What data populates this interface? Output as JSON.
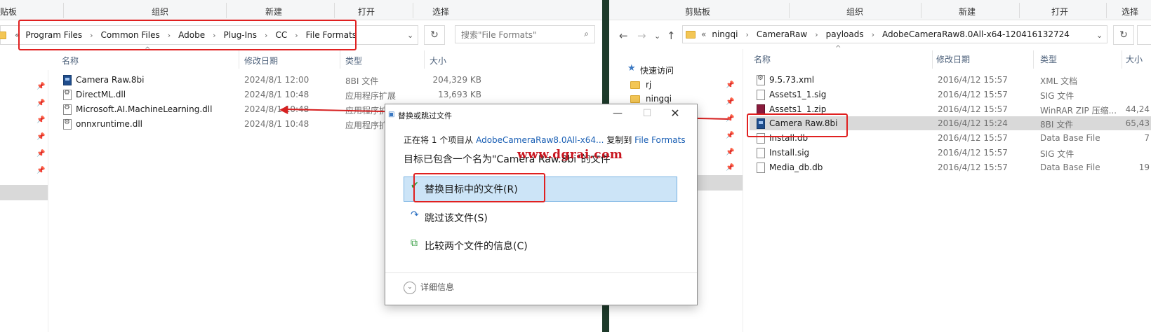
{
  "left": {
    "ribbon": [
      "贴板",
      "组织",
      "新建",
      "打开",
      "选择"
    ],
    "breadcrumb": [
      "Program Files",
      "Common Files",
      "Adobe",
      "Plug-Ins",
      "CC",
      "File Formats"
    ],
    "overflow": "«",
    "search_placeholder": "搜索\"File Formats\"",
    "columns": [
      "名称",
      "修改日期",
      "类型",
      "大小"
    ],
    "files": [
      {
        "name": "Camera Raw.8bi",
        "date": "2024/8/1 12:00",
        "type": "8BI 文件",
        "size": "204,329 KB",
        "icon": "camera-raw-icon"
      },
      {
        "name": "DirectML.dll",
        "date": "2024/8/1 10:48",
        "type": "应用程序扩展",
        "size": "13,693 KB",
        "icon": "dll-icon"
      },
      {
        "name": "Microsoft.AI.MachineLearning.dll",
        "date": "2024/8/1 10:48",
        "type": "应用程序扩",
        "size": "",
        "icon": "dll-icon"
      },
      {
        "name": "onnxruntime.dll",
        "date": "2024/8/1 10:48",
        "type": "应用程序扩",
        "size": "",
        "icon": "dll-icon"
      }
    ]
  },
  "right": {
    "ribbon": [
      "剪贴板",
      "组织",
      "新建",
      "打开",
      "选择"
    ],
    "breadcrumb": [
      "ningqi",
      "CameraRaw",
      "payloads",
      "AdobeCameraRaw8.0All-x64-120416132724"
    ],
    "overflow": "«",
    "sidebar": {
      "quick_access": "快速访问",
      "items": [
        "rj",
        "ningqi"
      ]
    },
    "columns": [
      "名称",
      "修改日期",
      "类型",
      "大小"
    ],
    "files": [
      {
        "name": "9.5.73.xml",
        "date": "2016/4/12 15:57",
        "type": "XML 文档",
        "size": "",
        "icon": "xml-icon"
      },
      {
        "name": "Assets1_1.sig",
        "date": "2016/4/12 15:57",
        "type": "SIG 文件",
        "size": "",
        "icon": "file-icon"
      },
      {
        "name": "Assets1_1.zip",
        "date": "2016/4/12 15:57",
        "type": "WinRAR ZIP 压缩...",
        "size": "44,24",
        "icon": "zip-icon"
      },
      {
        "name": "Camera Raw.8bi",
        "date": "2016/4/12 15:24",
        "type": "8BI 文件",
        "size": "65,43",
        "icon": "camera-raw-icon"
      },
      {
        "name": "Install.db",
        "date": "2016/4/12 15:57",
        "type": "Data Base File",
        "size": "7",
        "icon": "file-icon"
      },
      {
        "name": "Install.sig",
        "date": "2016/4/12 15:57",
        "type": "SIG 文件",
        "size": "",
        "icon": "file-icon"
      },
      {
        "name": "Media_db.db",
        "date": "2016/4/12 15:57",
        "type": "Data Base File",
        "size": "19",
        "icon": "file-icon"
      }
    ]
  },
  "dialog": {
    "title": "替换或跳过文件",
    "line1_prefix": "正在将 1 个项目从",
    "line1_source": "AdobeCameraRaw8.0All-x64...",
    "line1_mid": "复制到",
    "line1_dest": "File Formats",
    "line2": "目标已包含一个名为\"Camera Raw.8bi\"的文件",
    "watermark": "www.dgrai.com",
    "option_replace": "替换目标中的文件(R)",
    "option_skip": "跳过该文件(S)",
    "option_compare": "比较两个文件的信息(C)",
    "details": "详细信息"
  },
  "colors": {
    "highlight_red": "#e02020",
    "selection_blue": "#cce4f7",
    "link_blue": "#1a5fb4"
  }
}
